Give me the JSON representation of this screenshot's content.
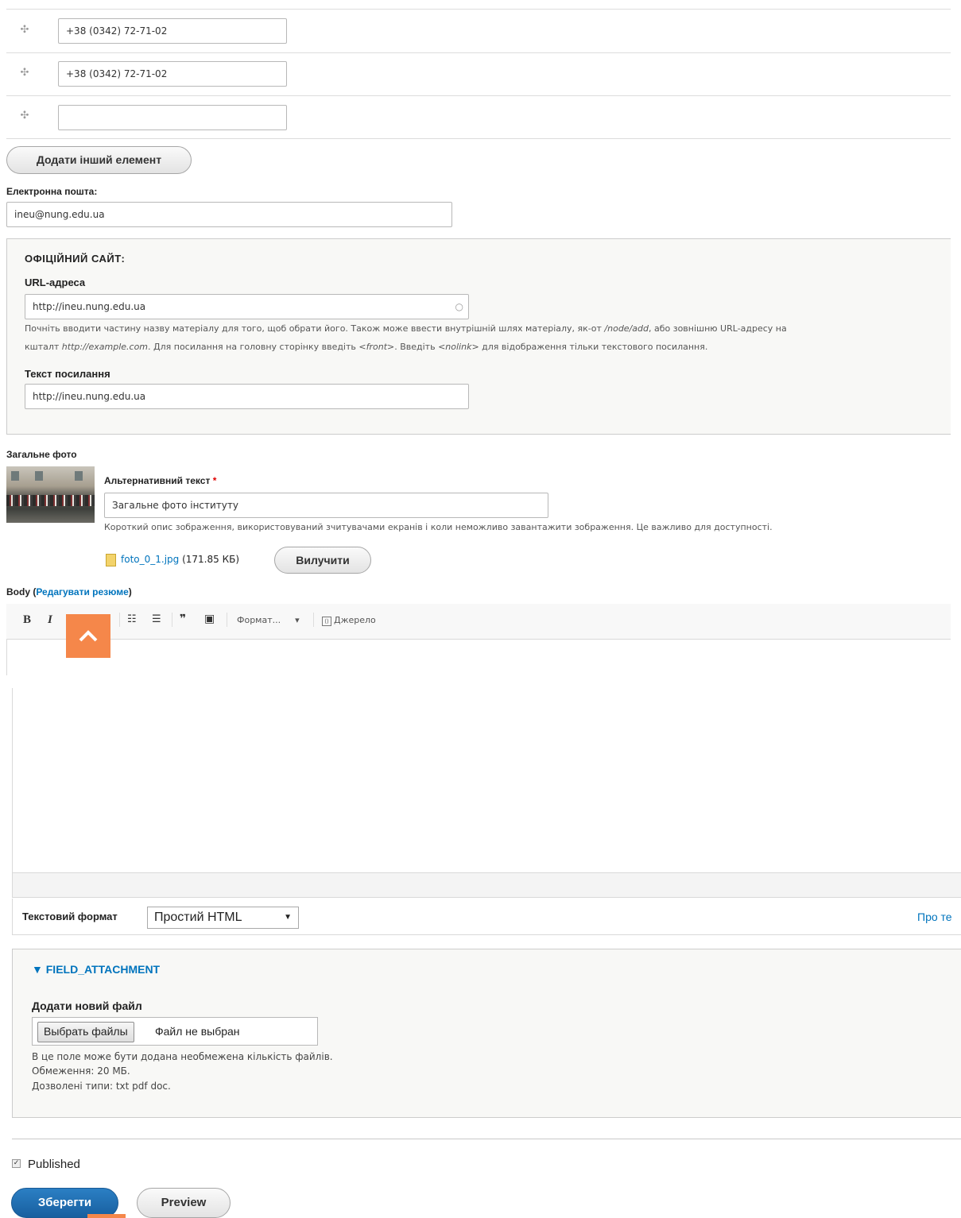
{
  "phones": {
    "values": [
      "+38 (0342) 72-71-02",
      "+38 (0342) 72-71-02",
      ""
    ],
    "add_button": "Додати інший елемент"
  },
  "email": {
    "label": "Електронна пошта:",
    "value": "ineu@nung.edu.ua"
  },
  "website": {
    "legend": "ОФІЦІЙНИЙ САЙТ:",
    "url_label": "URL-адреса",
    "url_value": "http://ineu.nung.edu.ua",
    "help_line1_a": "Почніть вводити частину назву матеріалу для того, щоб обрати його. Також може ввести внутрішній шлях матеріалу, як-от ",
    "help_line1_em": "/node/add",
    "help_line1_b": ", або зовнішню URL-адресу на",
    "help_line2_a": "кшталт ",
    "help_line2_em1": "http://example.com",
    "help_line2_b": ". Для посилання на головну сторінку введіть ",
    "help_line2_em2": "<front>",
    "help_line2_c": ". Введіть ",
    "help_line2_em3": "<nolink>",
    "help_line2_d": " для відображення тільки текстового посилання.",
    "link_text_label": "Текст посилання",
    "link_text_value": "http://ineu.nung.edu.ua"
  },
  "photo": {
    "label": "Загальне фото",
    "alt_label": "Альтернативний текст",
    "required_mark": "*",
    "alt_value": "Загальне фото інституту",
    "alt_help": "Короткий опис зображення, використовуваний зчитувачами екранів і коли неможливо завантажити зображення. Це важливо для доступності.",
    "file_name": "foto_0_1.jpg",
    "file_size": "(171.85 КБ)",
    "remove_button": "Вилучити"
  },
  "body": {
    "label": "Body",
    "paren_open": "(",
    "summary_link": "Редагувати резюме",
    "paren_close": ")",
    "toolbar": {
      "bold": "B",
      "italic": "I",
      "bullets": "☷",
      "numbers": "☰",
      "quote": "❞",
      "image": "▣",
      "format": "Формат...",
      "format_arrow": "▾",
      "source": "Джерело"
    },
    "text_format_label": "Текстовий формат",
    "text_format_value": "Простий HTML",
    "about_link": "Про те"
  },
  "attachment": {
    "legend": "▼ FIELD_ATTACHMENT",
    "add_label": "Додати новий файл",
    "choose_button": "Выбрать файлы",
    "no_file": "Файл не выбран",
    "help1": "В це поле може бути додана необмежена кількість файлів.",
    "help2": "Обмеження: 20 МБ.",
    "help3": "Дозволені типи: txt pdf doc."
  },
  "published": {
    "label": "Published",
    "checked": true
  },
  "actions": {
    "save": "Зберегти",
    "preview": "Preview"
  },
  "icons": {
    "drag": "drag-handle-icon",
    "scroll_top": "chevron-up-icon",
    "colors": {
      "accent": "#0074bd",
      "save_button": "#1f72b8",
      "scroll_top": "#f5874a",
      "required": "#e00000"
    }
  }
}
